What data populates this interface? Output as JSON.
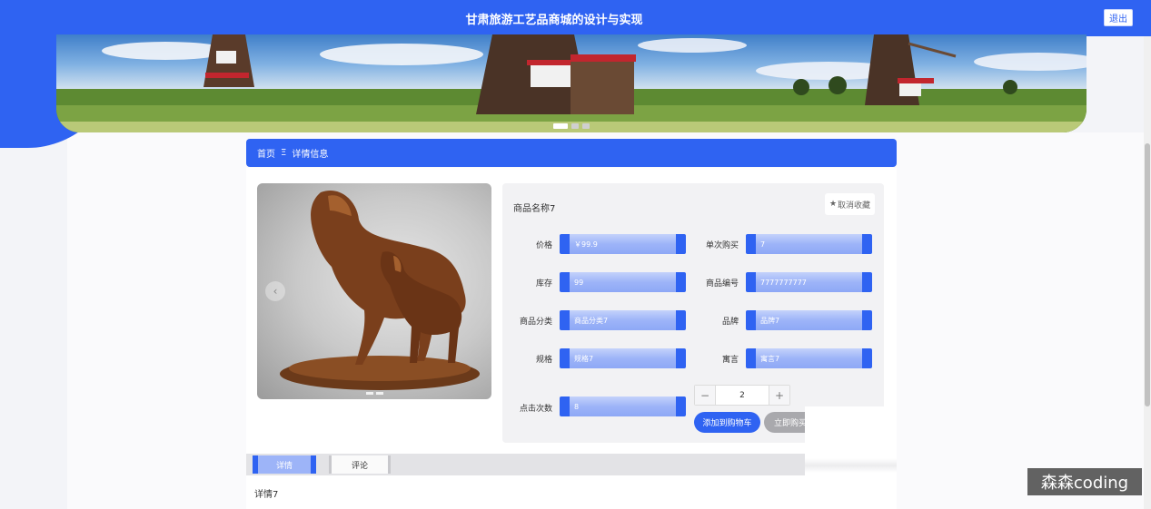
{
  "header": {
    "title": "甘肃旅游工艺品商城的设计与实现",
    "logout_label": "退出"
  },
  "banner": {
    "slide_count": 3,
    "active_slide": 1
  },
  "breadcrumb": {
    "home": "首页",
    "separator": "Ξ",
    "current": "详情信息"
  },
  "product": {
    "name": "商品名称7",
    "favorite_label": "取消收藏",
    "fields_left": [
      {
        "label": "价格",
        "value": "￥99.9"
      },
      {
        "label": "库存",
        "value": "99"
      },
      {
        "label": "商品分类",
        "value": "商品分类7"
      },
      {
        "label": "规格",
        "value": "规格7"
      },
      {
        "label": "点击次数",
        "value": "8"
      }
    ],
    "fields_right": [
      {
        "label": "单次购买",
        "value": "7"
      },
      {
        "label": "商品编号",
        "value": "7777777777"
      },
      {
        "label": "品牌",
        "value": "品牌7"
      },
      {
        "label": "寓言",
        "value": "寓言7"
      }
    ],
    "quantity": "2",
    "add_to_cart_label": "添加到购物车",
    "buy_now_label": "立即购买"
  },
  "tabs": [
    {
      "label": "详情",
      "active": true
    },
    {
      "label": "评论",
      "active": false
    }
  ],
  "detail_text": "详情7",
  "watermark": "森森coding",
  "colors": {
    "primary": "#2f63f2",
    "field_fill": "#9db4f8",
    "buy_disabled": "#a9a9ad"
  },
  "icons": [
    "prev-arrow-icon",
    "star-icon",
    "minus-icon",
    "plus-icon"
  ]
}
